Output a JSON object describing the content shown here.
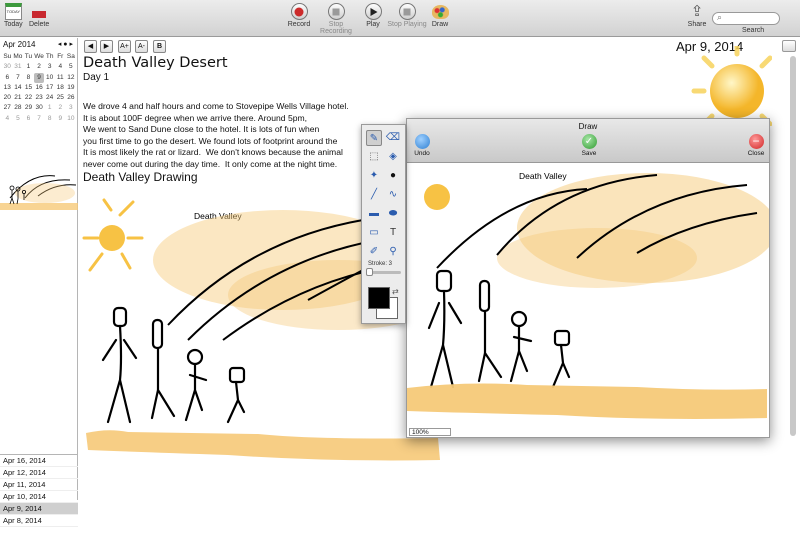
{
  "toolbar": {
    "today": "Today",
    "today_icon_text": "TODAY",
    "delete": "Delete",
    "record": "Record",
    "stop_recording": "Stop Recording",
    "play": "Play",
    "stop_playing": "Stop Playing",
    "draw": "Draw",
    "share": "Share",
    "search": "Search"
  },
  "calendar": {
    "month": "Apr 2014",
    "weekdays": [
      "Su",
      "Mo",
      "Tu",
      "We",
      "Th",
      "Fr",
      "Sa"
    ],
    "weeks": [
      [
        "30",
        "31",
        "1",
        "2",
        "3",
        "4",
        "5"
      ],
      [
        "6",
        "7",
        "8",
        "9",
        "10",
        "11",
        "12"
      ],
      [
        "13",
        "14",
        "15",
        "16",
        "17",
        "18",
        "19"
      ],
      [
        "20",
        "21",
        "22",
        "23",
        "24",
        "25",
        "26"
      ],
      [
        "27",
        "28",
        "29",
        "30",
        "1",
        "2",
        "3"
      ],
      [
        "4",
        "5",
        "6",
        "7",
        "8",
        "9",
        "10"
      ]
    ]
  },
  "note_list": [
    "Apr 16, 2014",
    "Apr 12, 2014",
    "Apr 11, 2014",
    "Apr 10, 2014",
    "Apr 9, 2014",
    "Apr 8, 2014"
  ],
  "selected_note": "Apr 9, 2014",
  "format_buttons": [
    "◀",
    "▶",
    "A+",
    "A-",
    "B"
  ],
  "note": {
    "date": "Apr 9, 2014",
    "title": "Death Valley Desert",
    "subtitle": "Day 1",
    "body": [
      "We drove 4 and half hours and come to Stovepipe Wells Village hotel.",
      "It is about 100F degree when we arrive there. Around 5pm,",
      "We went to Sand Dune close to the hotel. It is lots of fun when",
      "you first time to go the desert. We found lots of footprint around the",
      "It is most likely the rat or lizard.  We don't knows because the animal",
      "never come out during the day time.  It only come at the night time."
    ],
    "drawing_heading": "Death Valley Drawing",
    "drawing_label": "Death Valley"
  },
  "draw_window": {
    "title": "Draw",
    "undo": "Undo",
    "save": "Save",
    "close": "Close",
    "zoom": "100%",
    "canvas_label": "Death Valley"
  },
  "palette": {
    "stroke_label": "Stroke: 3",
    "stroke_value": 3
  },
  "colors": {
    "sand": "#f6c978",
    "sun": "#f7c244",
    "record": "#cc2a2a",
    "save": "#2f9a2f",
    "close": "#d02424",
    "undo": "#2d7fd2"
  }
}
